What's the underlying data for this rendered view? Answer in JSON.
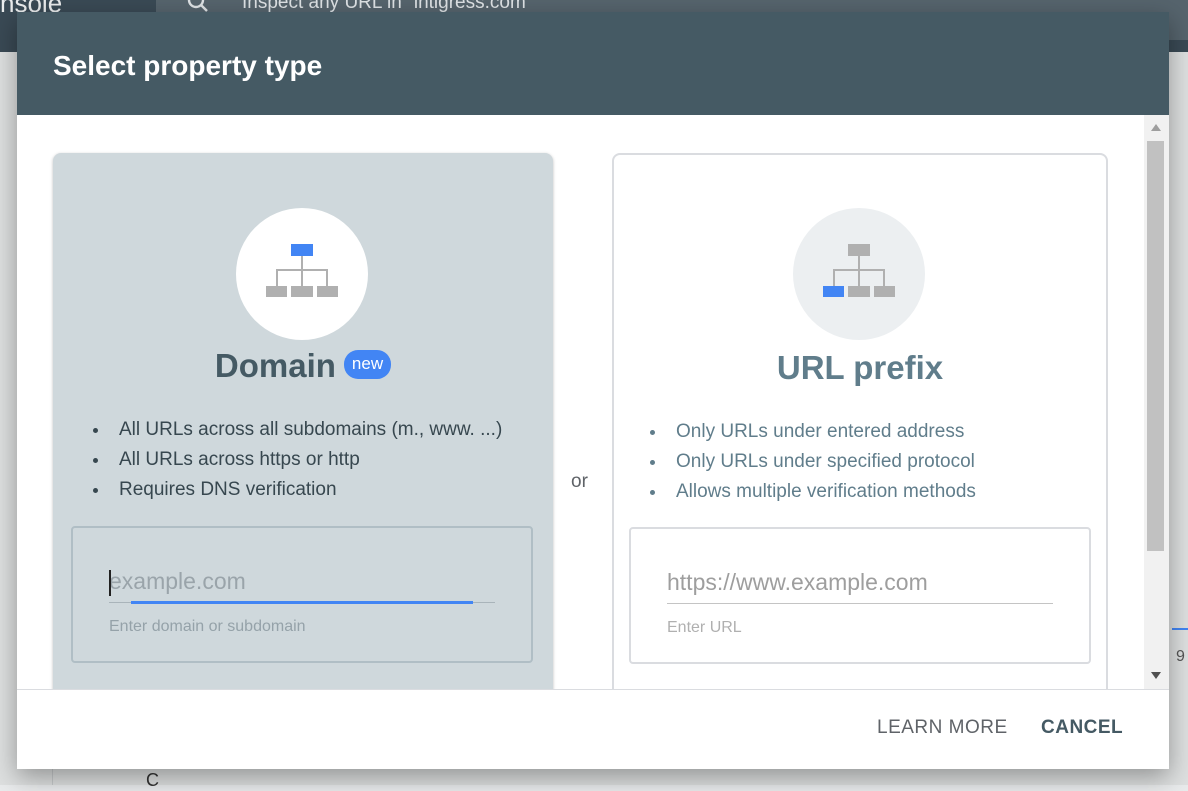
{
  "background": {
    "brand_fragment": "nsole",
    "search_placeholder": "Inspect any URL in \"intigress.com\"",
    "peek_text": "C",
    "right_fragment": "9"
  },
  "dialog": {
    "title": "Select property type",
    "separator": "or",
    "domain_card": {
      "title": "Domain",
      "badge": "new",
      "bullets": [
        "All URLs across all subdomains (m., www. ...)",
        "All URLs across https or http",
        "Requires DNS verification"
      ],
      "input_placeholder": "example.com",
      "input_value": "",
      "helper": "Enter domain or subdomain",
      "icon": "sitemap-icon",
      "highlight_color": "#4285f4"
    },
    "url_card": {
      "title": "URL prefix",
      "bullets": [
        "Only URLs under entered address",
        "Only URLs under specified protocol",
        "Allows multiple verification methods"
      ],
      "input_placeholder": "https://www.example.com",
      "input_value": "",
      "helper": "Enter URL",
      "icon": "sitemap-icon"
    },
    "footer": {
      "learn_more": "LEARN MORE",
      "cancel": "CANCEL"
    },
    "colors": {
      "header": "#455a64",
      "accent": "#4285f4",
      "selected_card": "#cfd8dc"
    }
  }
}
